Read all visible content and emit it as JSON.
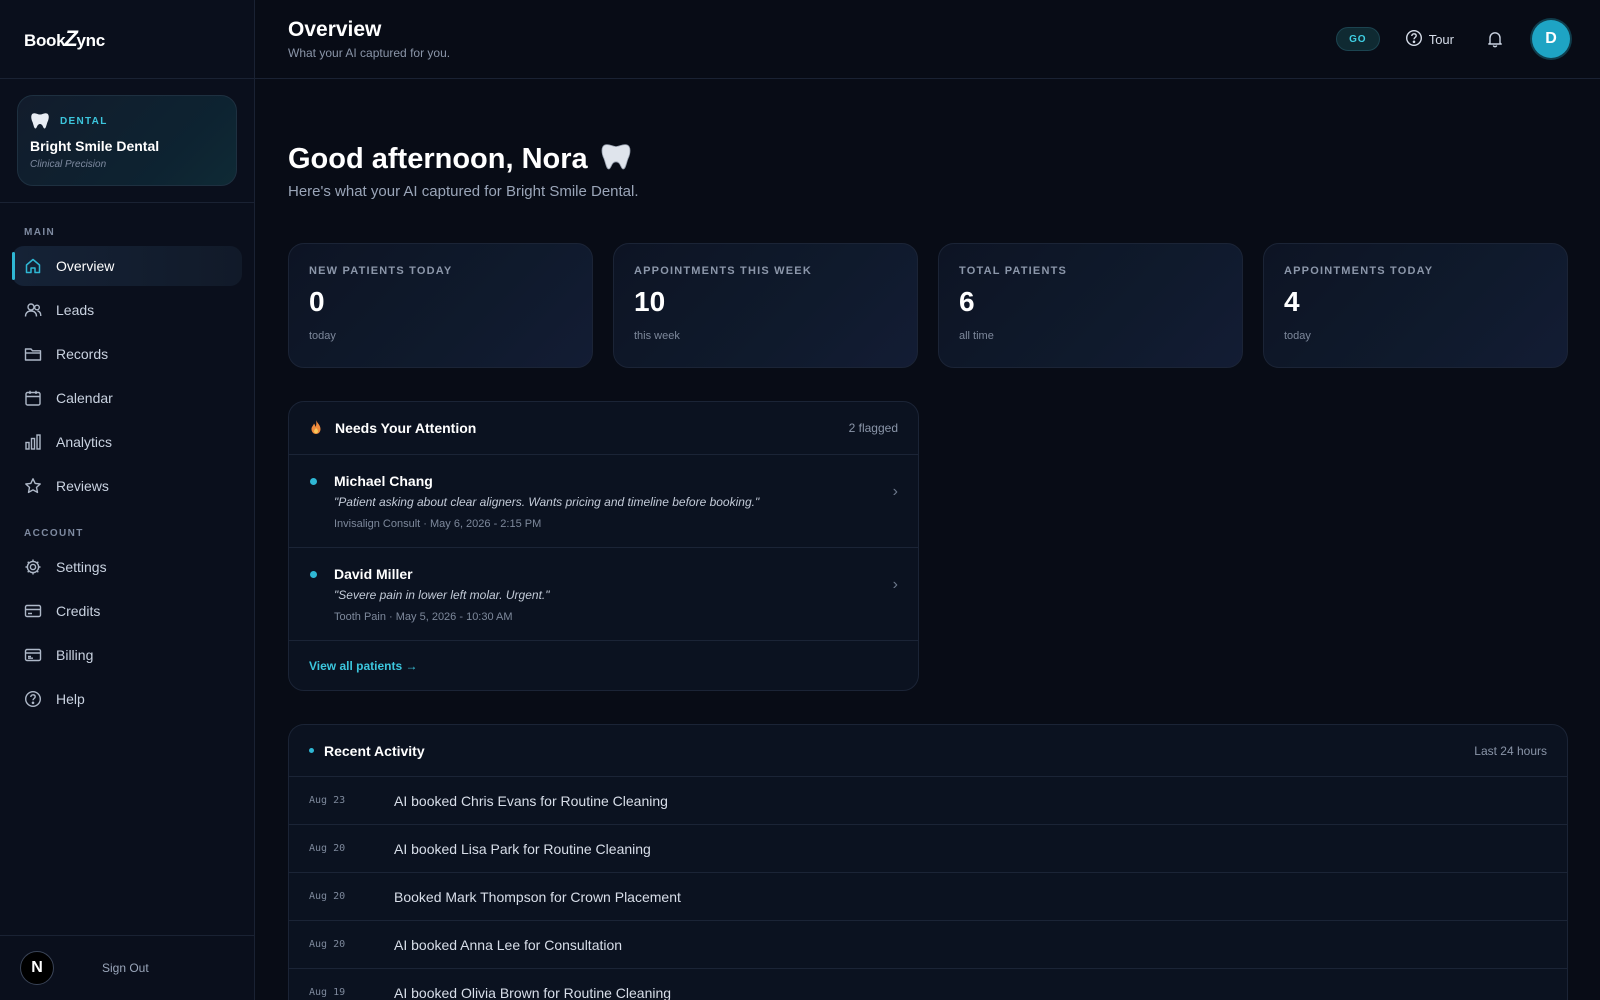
{
  "brand": {
    "part1": "Book",
    "part2": "Z",
    "part3": "ync"
  },
  "clinic": {
    "tag": "DENTAL",
    "name": "Bright Smile Dental",
    "tagline": "Clinical Precision"
  },
  "nav": {
    "main_heading": "MAIN",
    "main_items": [
      {
        "label": "Overview",
        "icon": "home-icon",
        "active": true
      },
      {
        "label": "Leads",
        "icon": "users-icon"
      },
      {
        "label": "Records",
        "icon": "folder-icon"
      },
      {
        "label": "Calendar",
        "icon": "calendar-icon"
      },
      {
        "label": "Analytics",
        "icon": "bar-chart-icon"
      },
      {
        "label": "Reviews",
        "icon": "star-icon"
      }
    ],
    "account_heading": "ACCOUNT",
    "account_items": [
      {
        "label": "Settings",
        "icon": "gear-icon"
      },
      {
        "label": "Credits",
        "icon": "credit-card-icon"
      },
      {
        "label": "Billing",
        "icon": "billing-icon"
      },
      {
        "label": "Help",
        "icon": "help-icon"
      }
    ]
  },
  "footer": {
    "avatar_letter": "N",
    "signout": "Sign Out"
  },
  "header": {
    "title": "Overview",
    "subtitle": "What your AI captured for you.",
    "go_label": "GO",
    "tour_label": "Tour",
    "avatar_letter": "D"
  },
  "greeting": {
    "title": "Good afternoon, Nora",
    "subtitle": "Here's what your AI captured for Bright Smile Dental."
  },
  "stats": [
    {
      "label": "NEW PATIENTS TODAY",
      "value": "0",
      "sub": "today"
    },
    {
      "label": "APPOINTMENTS THIS WEEK",
      "value": "10",
      "sub": "this week"
    },
    {
      "label": "TOTAL PATIENTS",
      "value": "6",
      "sub": "all time"
    },
    {
      "label": "APPOINTMENTS TODAY",
      "value": "4",
      "sub": "today"
    }
  ],
  "attention": {
    "title": "Needs Your Attention",
    "count": "2 flagged",
    "items": [
      {
        "name": "Michael Chang",
        "quote": "\"Patient asking about clear aligners. Wants pricing and timeline before booking.\"",
        "meta": "Invisalign Consult · May 6, 2026 - 2:15 PM"
      },
      {
        "name": "David Miller",
        "quote": "\"Severe pain in lower left molar. Urgent.\"",
        "meta": "Tooth Pain · May 5, 2026 - 10:30 AM"
      }
    ],
    "view_all": "View all patients →"
  },
  "activity": {
    "title": "Recent Activity",
    "range": "Last 24 hours",
    "items": [
      {
        "date": "Aug 23",
        "text": "AI booked Chris Evans for Routine Cleaning"
      },
      {
        "date": "Aug 20",
        "text": "AI booked Lisa Park for Routine Cleaning"
      },
      {
        "date": "Aug 20",
        "text": "Booked Mark Thompson for Crown Placement"
      },
      {
        "date": "Aug 20",
        "text": "AI booked Anna Lee for Consultation"
      },
      {
        "date": "Aug 19",
        "text": "AI booked Olivia Brown for Routine Cleaning"
      }
    ]
  },
  "colors": {
    "accent": "#2fb7d4",
    "background": "#080c16",
    "card": "#0b1220"
  }
}
